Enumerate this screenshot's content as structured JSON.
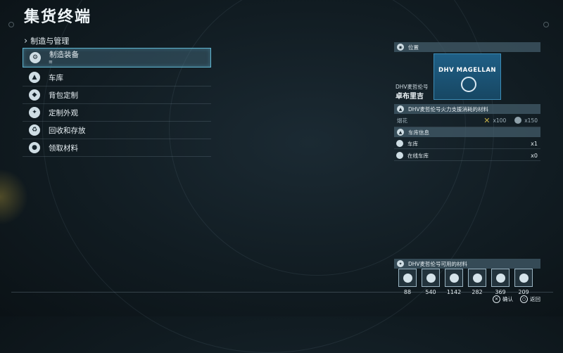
{
  "header": {
    "title": "集货终端"
  },
  "breadcrumb": {
    "label": "制造与管理"
  },
  "menu": {
    "items": [
      {
        "label": "制造装备",
        "icon": "gear-icon",
        "selected": true,
        "sub": "≡"
      },
      {
        "label": "车库",
        "icon": "vehicle-icon"
      },
      {
        "label": "背包定制",
        "icon": "backpack-icon"
      },
      {
        "label": "定制外观",
        "icon": "customize-icon"
      },
      {
        "label": "回收和存放",
        "icon": "recycle-icon"
      },
      {
        "label": "领取材料",
        "icon": "pickup-icon"
      }
    ]
  },
  "right": {
    "location_label": "位置",
    "location_image_name": "DHV MAGELLAN",
    "ship_label": "DHV麦哲伦号",
    "place": "卓布里吉",
    "support_label": "DHV麦哲伦号火力支援消耗的材料",
    "support_item": "烟花",
    "support_cost1": "x100",
    "support_cost2": "x150",
    "vehicle_info_label": "车库信息",
    "vehicle_rows": [
      {
        "label": "车库",
        "count": "x1",
        "icon": "garage-icon"
      },
      {
        "label": "在线车库",
        "count": "x0",
        "icon": "online-garage-icon"
      }
    ],
    "materials_label": "DHV麦哲伦号可用的材料",
    "materials": [
      {
        "icon": "chiral-crystal-icon",
        "value": "88"
      },
      {
        "icon": "resin-icon",
        "value": "540"
      },
      {
        "icon": "metal-icon",
        "value": "1142"
      },
      {
        "icon": "ceramic-icon",
        "value": "282"
      },
      {
        "icon": "chemical-icon",
        "value": "369"
      },
      {
        "icon": "special-alloy-icon",
        "value": "209"
      }
    ]
  },
  "footer": {
    "confirm": "确认",
    "back": "返回"
  },
  "colors": {
    "accent": "#5fb4cf",
    "location_bg": "#1f5f86"
  }
}
